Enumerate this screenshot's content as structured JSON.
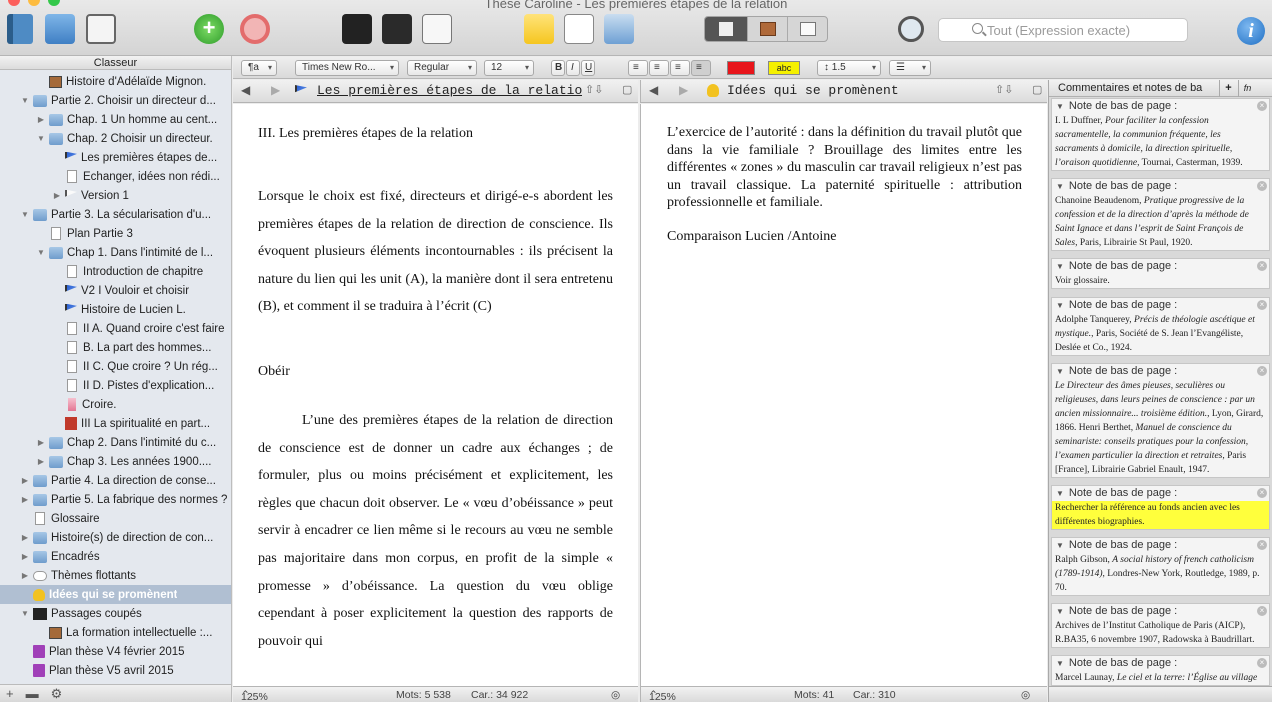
{
  "window": {
    "title": "Thèse Caroline - Les premières étapes de la relation"
  },
  "toolbar": {
    "search_placeholder": "Tout (Expression exacte)"
  },
  "sidebar": {
    "header": "Classeur",
    "items": [
      {
        "label": "Histoire d'Adélaïde Mignon.",
        "depth": 2,
        "icon": "photo",
        "tri": ""
      },
      {
        "label": "Partie 2. Choisir un directeur d...",
        "depth": 1,
        "icon": "folder",
        "tri": "▼"
      },
      {
        "label": "Chap. 1 Un homme au cent...",
        "depth": 2,
        "icon": "folder",
        "tri": "▶"
      },
      {
        "label": "Chap. 2 Choisir un directeur.",
        "depth": 2,
        "icon": "folder",
        "tri": "▼"
      },
      {
        "label": "Les premières étapes de...",
        "depth": 3,
        "icon": "flag-blue",
        "tri": ""
      },
      {
        "label": "Echanger, idées non rédi...",
        "depth": 3,
        "icon": "doc",
        "tri": ""
      },
      {
        "label": "Version 1",
        "depth": 3,
        "icon": "flag-white",
        "tri": "▶"
      },
      {
        "label": "Partie 3. La sécularisation d'u...",
        "depth": 1,
        "icon": "folder",
        "tri": "▼"
      },
      {
        "label": "Plan Partie 3",
        "depth": 2,
        "icon": "doc",
        "tri": ""
      },
      {
        "label": "Chap 1. Dans l'intimité de l...",
        "depth": 2,
        "icon": "folder",
        "tri": "▼"
      },
      {
        "label": "Introduction de chapitre",
        "depth": 3,
        "icon": "doc",
        "tri": ""
      },
      {
        "label": "V2 I Vouloir et choisir",
        "depth": 3,
        "icon": "flag-blue",
        "tri": ""
      },
      {
        "label": "Histoire de Lucien L.",
        "depth": 3,
        "icon": "flag-blue",
        "tri": ""
      },
      {
        "label": "II A. Quand croire c'est faire",
        "depth": 3,
        "icon": "doc",
        "tri": ""
      },
      {
        "label": "B. La part des hommes...",
        "depth": 3,
        "icon": "doc",
        "tri": ""
      },
      {
        "label": "II C. Que croire ? Un rég...",
        "depth": 3,
        "icon": "doc",
        "tri": ""
      },
      {
        "label": "II D. Pistes d'explication...",
        "depth": 3,
        "icon": "doc",
        "tri": ""
      },
      {
        "label": "Croire.",
        "depth": 3,
        "icon": "pink",
        "tri": ""
      },
      {
        "label": "III La spiritualité en part...",
        "depth": 3,
        "icon": "red",
        "tri": ""
      },
      {
        "label": "Chap 2. Dans l'intimité du c...",
        "depth": 2,
        "icon": "folder",
        "tri": "▶"
      },
      {
        "label": "Chap 3. Les années 1900....",
        "depth": 2,
        "icon": "folder",
        "tri": "▶"
      },
      {
        "label": "Partie 4. La direction de conse...",
        "depth": 1,
        "icon": "folder",
        "tri": "▶"
      },
      {
        "label": "Partie 5. La fabrique des normes ?",
        "depth": 1,
        "icon": "folder",
        "tri": "▶"
      },
      {
        "label": "Glossaire",
        "depth": 1,
        "icon": "doc",
        "tri": ""
      },
      {
        "label": "Histoire(s) de direction de con...",
        "depth": 1,
        "icon": "folder",
        "tri": "▶"
      },
      {
        "label": "Encadrés",
        "depth": 1,
        "icon": "folder",
        "tri": "▶"
      },
      {
        "label": "Thèmes flottants",
        "depth": 1,
        "icon": "cloud",
        "tri": "▶"
      },
      {
        "label": "Idées qui se promènent",
        "depth": 1,
        "icon": "bulb",
        "tri": "",
        "selected": true
      },
      {
        "label": "Passages coupés",
        "depth": 1,
        "icon": "film",
        "tri": "▼"
      },
      {
        "label": "La formation intellectuelle :...",
        "depth": 2,
        "icon": "photo",
        "tri": ""
      },
      {
        "label": "Plan thèse V4 février 2015",
        "depth": 1,
        "icon": "flag-purple",
        "tri": ""
      },
      {
        "label": "Plan thèse V5 avril 2015",
        "depth": 1,
        "icon": "flag-purple",
        "tri": ""
      }
    ]
  },
  "formatbar": {
    "style": "¶a",
    "font": "Times New Ro...",
    "weight": "Regular",
    "size": "12",
    "bold": "B",
    "italic": "I",
    "underline": "U",
    "highlight_label": "abc",
    "line_spacing": "1.5",
    "colors": {
      "text": "#e8151b",
      "highlight": "#f5f000"
    }
  },
  "editor1": {
    "title": "Les premières étapes de la relation",
    "zoom": "125%",
    "words": "Mots: 5 538",
    "chars": "Car.: 34 922",
    "paragraphs": [
      "III. Les premières étapes de la relation",
      "Lorsque le choix est fixé, directeurs et dirigé-e-s abordent les premières étapes de la relation de direction de conscience. Ils évoquent plusieurs éléments incontournables : ils précisent la nature du lien qui les unit (A), la manière dont il sera entretenu (B), et comment il se traduira à l’écrit (C)",
      "Obéir",
      "L’une des premières étapes de la relation de direction de conscience est de donner un cadre aux échanges ; de formuler, plus ou moins précisément et explicitement, les règles que chacun doit observer.   Le « vœu d’obéissance » peut servir à encadrer ce lien même si le recours au vœu ne semble pas majoritaire dans mon corpus, en profit de la simple « promesse » d’obéissance. La question du vœu oblige cependant à poser explicitement la question des rapports de pouvoir qui"
    ]
  },
  "editor2": {
    "title": "Idées qui se promènent",
    "zoom": "125%",
    "words": "Mots: 41",
    "chars": "Car.: 310",
    "paragraphs": [
      "L’exercice de l’autorité : dans la définition du travail plutôt que dans la vie familiale ? Brouillage des limites entre les différentes « zones » du masculin car travail religieux n’est pas un travail classique. La paternité spirituelle : attribution professionnelle et familiale.",
      "Comparaison Lucien /Antoine"
    ]
  },
  "notes": {
    "header": "Commentaires et notes de ba",
    "add_label": "+",
    "fn_label": "fn",
    "note_label": "Note de bas de page :",
    "items": [
      {
        "html": "I. L Duffner, <i>Pour faciliter la confession sacramentelle, la communion fréquente, les sacraments à domicile, la direction spirituelle, l’oraison quotidienne</i>, Tournai, Casterman, 1939."
      },
      {
        "html": "Chanoine Beaudenom, <i>Pratique progressive de la confession et de la direction d’après la méthode de Saint Ignace et dans l’esprit de Saint François de Sales</i>, Paris, Librairie St Paul, 1920."
      },
      {
        "html": "Voir glossaire."
      },
      {
        "html": "Adolphe Tanquerey, <i>Précis de théologie ascétique et mystique.</i>, Paris, Société de S. Jean l’Evangéliste, Deslée et Co., 1924."
      },
      {
        "html": "<i>Le Directeur des âmes pieuses, seculières ou religieuses, dans leurs peines de conscience : par un ancien missionnaire... troisième édition.</i>, Lyon, Girard, 1866. Henri Berthet, <i>Manuel de conscience du seminariste: conseils pratiques pour la confession, l’examen particulier la direction et retraites</i>, Paris [France], Librairie Gabriel Enault, 1947."
      },
      {
        "html": "Rechercher la référence au fonds ancien avec les différentes biographies.",
        "highlight": true
      },
      {
        "html": "Ralph Gibson, <i>A social history of french catholicism (1789-1914)</i>, Londres-New York, Routledge, 1989, p. 70."
      },
      {
        "html": "Archives de l’Institut Catholique de Paris (AICP), R.BA35, 6 novembre 1907, Radowska à Baudrillart."
      },
      {
        "html": "Marcel Launay, <i>Le ciel et la terre: l’Église au village</i>"
      }
    ]
  }
}
